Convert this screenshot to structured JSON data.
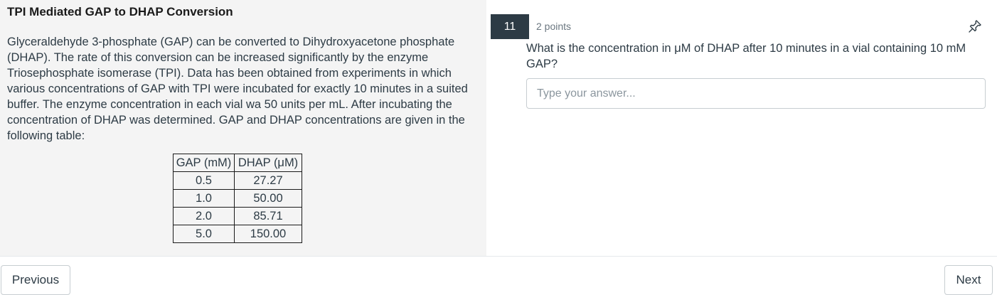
{
  "passage": {
    "title": "TPI Mediated GAP to DHAP Conversion",
    "body": "Glyceraldehyde 3-phosphate (GAP) can be converted to Dihydroxyacetone phosphate (DHAP). The rate of this conversion can be increased significantly by the enzyme Triosephosphate isomerase (TPI). Data has been obtained from experiments in which various concentrations of GAP with TPI were incubated for exactly 10 minutes in a suited buffer. The enzyme concentration in each vial wa 50 units per mL. After incubating the concentration of DHAP was determined. GAP and DHAP concentrations are given in the following table:",
    "table": {
      "headers": [
        "GAP (mM)",
        "DHAP (μM)"
      ],
      "rows": [
        [
          "0.5",
          "27.27"
        ],
        [
          "1.0",
          "50.00"
        ],
        [
          "2.0",
          "85.71"
        ],
        [
          "5.0",
          "150.00"
        ]
      ]
    }
  },
  "question": {
    "number": "11",
    "points": "2 points",
    "text": "What is the concentration in μM of DHAP after 10 minutes in a vial containing 10 mM GAP?",
    "answer_placeholder": "Type your answer...",
    "answer_value": "",
    "pin_icon": "pin-icon"
  },
  "nav": {
    "previous_label": "Previous",
    "next_label": "Next"
  },
  "colors": {
    "passage_bg": "#f4f4f4",
    "badge_bg": "#2d3b45",
    "text": "#2d3b45",
    "muted": "#6b7780",
    "border": "#c7cdd1"
  }
}
